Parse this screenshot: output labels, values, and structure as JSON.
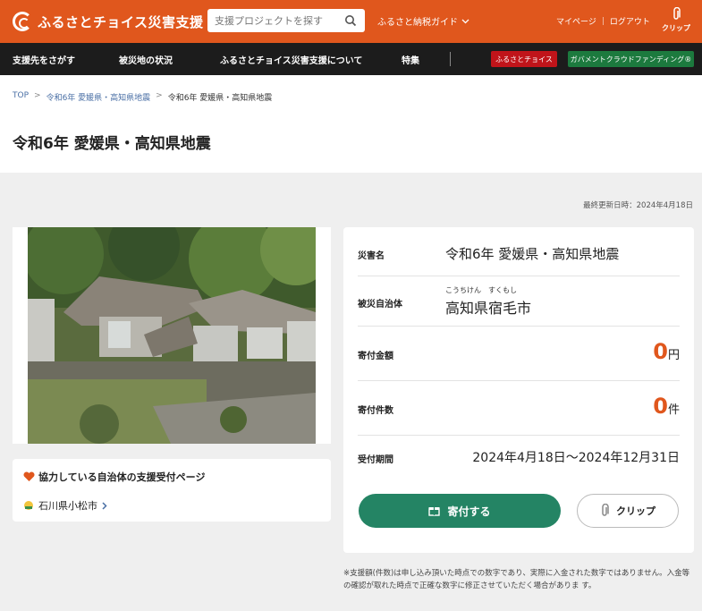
{
  "header": {
    "logo_text": "ふるさとチョイス災害支援",
    "search_placeholder": "支援プロジェクトを探す",
    "guide_label": "ふるさと納税ガイド",
    "mypage_label": "マイページ",
    "logout_label": "ログアウト",
    "clip_label": "クリップ"
  },
  "nav": {
    "items": [
      "支援先をさがす",
      "被災地の状況",
      "ふるさとチョイス災害支援について",
      "特集"
    ],
    "badge_red": "ふるさとチョイス",
    "badge_green": "ガバメントクラウドファンディング®"
  },
  "breadcrumb": [
    "TOP",
    "令和6年 愛媛県・高知県地震",
    "令和6年 愛媛県・高知県地震"
  ],
  "page_title": "令和6年 愛媛県・高知県地震",
  "updated": "最終更新日時：2024年4月18日",
  "municipality": {
    "title": "協力している自治体の支援受付ページ",
    "link": "石川県小松市"
  },
  "info": {
    "disaster_label": "災害名",
    "disaster_value": "令和6年 愛媛県・高知県地震",
    "area_label": "被災自治体",
    "area_ruby": "こうちけん　すくもし",
    "area_value": "高知県宿毛市",
    "amount_label": "寄付金額",
    "amount_value": "0",
    "amount_unit": "円",
    "count_label": "寄付件数",
    "count_value": "0",
    "count_unit": "件",
    "period_label": "受付期間",
    "period_value": "2024年4月18日～2024年12月31日",
    "donate_button": "寄付する",
    "clip_button": "クリップ"
  },
  "note": "※支援額(件数)は申し込み頂いた時点での数字であり、実際に入金された数字ではありません。入金等の確認が取れた時点で正確な数字に修正させていただく場合がありま す。",
  "colors": {
    "brand_orange": "#e0571d",
    "donate_green": "#248464",
    "nav_dark": "#1c1c1c"
  }
}
